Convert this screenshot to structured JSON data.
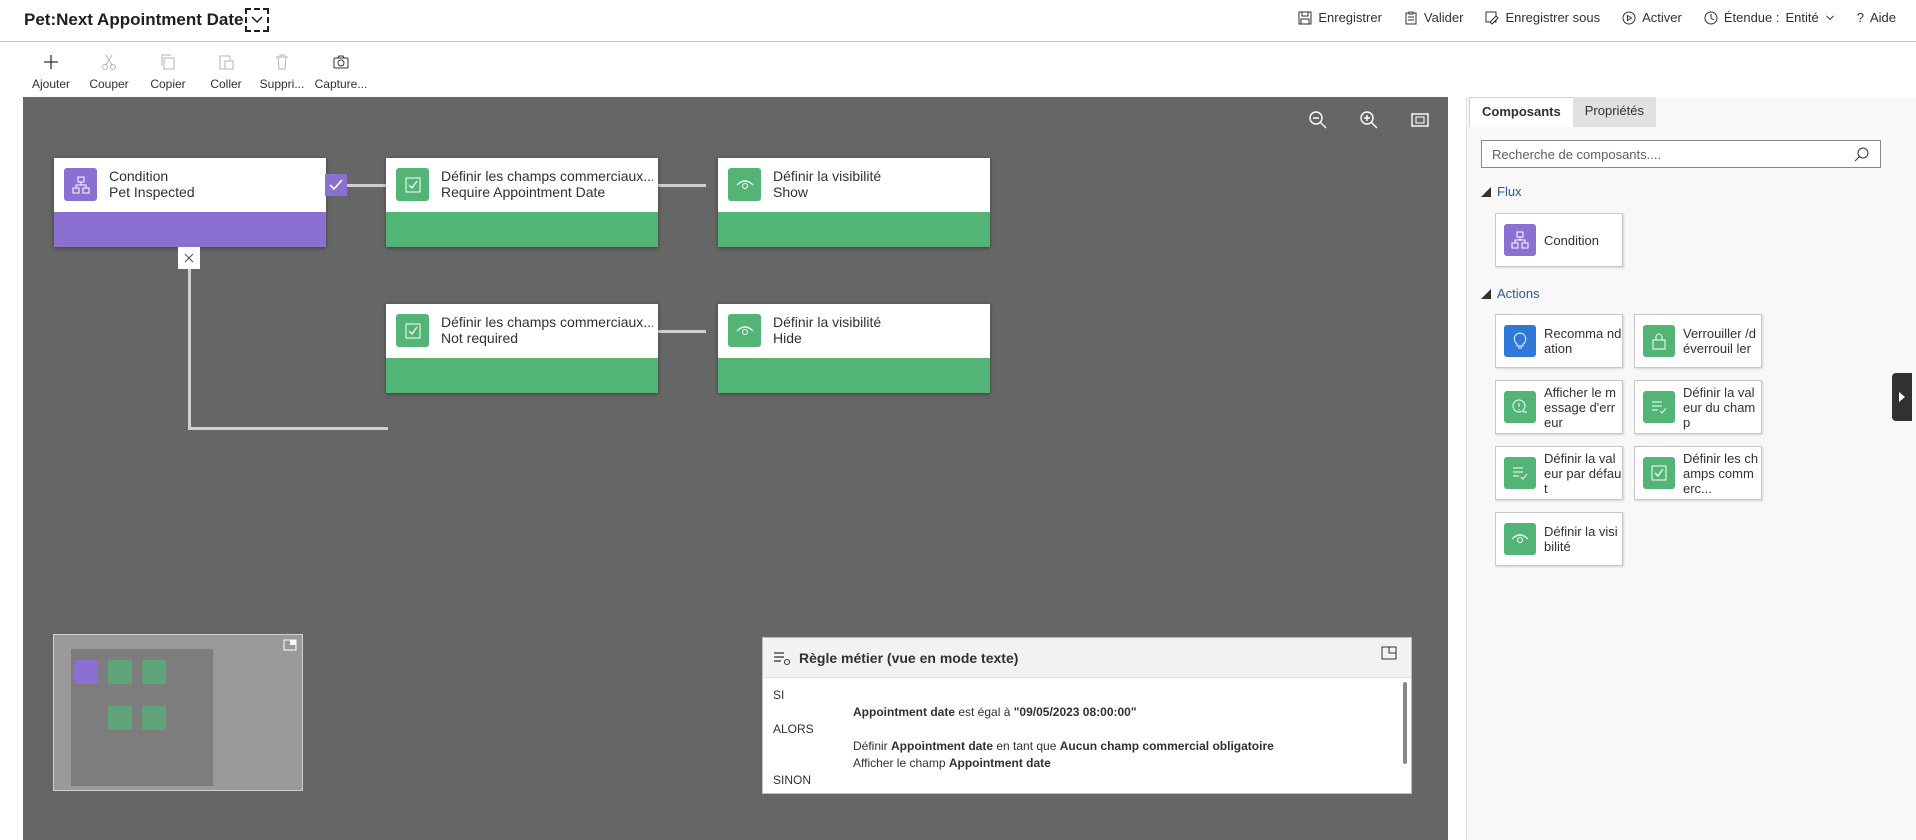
{
  "header": {
    "title": "Pet:Next Appointment Date",
    "actions": {
      "save": "Enregistrer",
      "validate": "Valider",
      "save_as": "Enregistrer sous",
      "activate": "Activer",
      "scope_label": "Étendue :",
      "scope_value": "Entité",
      "help": "Aide"
    }
  },
  "ribbon": {
    "add": "Ajouter",
    "cut": "Couper",
    "copy": "Copier",
    "paste": "Coller",
    "delete": "Suppri...",
    "capture": "Capture..."
  },
  "canvas": {
    "condition_node": {
      "title": "Condition",
      "subtitle": "Pet Inspected"
    },
    "node_set_required": {
      "title": "Définir les champs commerciaux...",
      "subtitle": "Require Appointment Date"
    },
    "node_show": {
      "title": "Définir la visibilité",
      "subtitle": "Show"
    },
    "node_not_required": {
      "title": "Définir les champs commerciaux...",
      "subtitle": "Not required"
    },
    "node_hide": {
      "title": "Définir la visibilité",
      "subtitle": "Hide"
    }
  },
  "text_view": {
    "title": "Règle métier (vue en mode texte)",
    "if_label": "SI",
    "if_field": "Appointment date",
    "if_op": " est égal à ",
    "if_value": "\"09/05/2023 08:00:00\"",
    "then_label": "ALORS",
    "then1_prefix": "Définir ",
    "then1_field": "Appointment date",
    "then1_mid": " en tant que ",
    "then1_value": "Aucun champ commercial obligatoire",
    "then2_prefix": "Afficher le champ ",
    "then2_field": "Appointment date",
    "else_label": "SINON"
  },
  "side_panel": {
    "tabs": [
      "Composants",
      "Propriétés"
    ],
    "search_placeholder": "Recherche de composants....",
    "flow_label": "Flux",
    "flow_items": [
      "Condition"
    ],
    "actions_label": "Actions",
    "action_items": [
      "Recomma ndation",
      "Verrouiller /déverrouil ler",
      "Afficher le message d'erreur",
      "Définir la valeur du champ",
      "Définir la valeur par défaut",
      "Définir les champs commerc...",
      "Définir la visibilité"
    ]
  },
  "colors": {
    "condition": "#8a70d0",
    "action": "#52b576",
    "recommendation": "#2f7ad8",
    "canvas": "#666666"
  }
}
